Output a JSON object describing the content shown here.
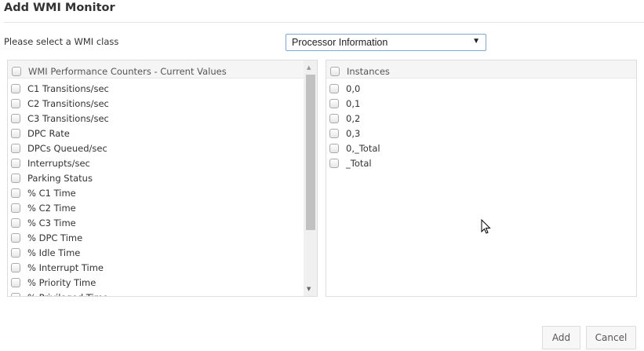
{
  "title": "Add WMI Monitor",
  "class_label": "Please select a WMI class",
  "class_select": {
    "value": "Processor Information"
  },
  "counters": {
    "header": "WMI Performance Counters - Current Values",
    "items": [
      "C1 Transitions/sec",
      "C2 Transitions/sec",
      "C3 Transitions/sec",
      "DPC Rate",
      "DPCs Queued/sec",
      "Interrupts/sec",
      "Parking Status",
      "% C1 Time",
      "% C2 Time",
      "% C3 Time",
      "% DPC Time",
      "% Idle Time",
      "% Interrupt Time",
      "% Priority Time",
      "% Privileged Time"
    ]
  },
  "instances": {
    "header": "Instances",
    "items": [
      "0,0",
      "0,1",
      "0,2",
      "0,3",
      "0,_Total",
      "_Total"
    ]
  },
  "buttons": {
    "add": "Add",
    "cancel": "Cancel"
  }
}
